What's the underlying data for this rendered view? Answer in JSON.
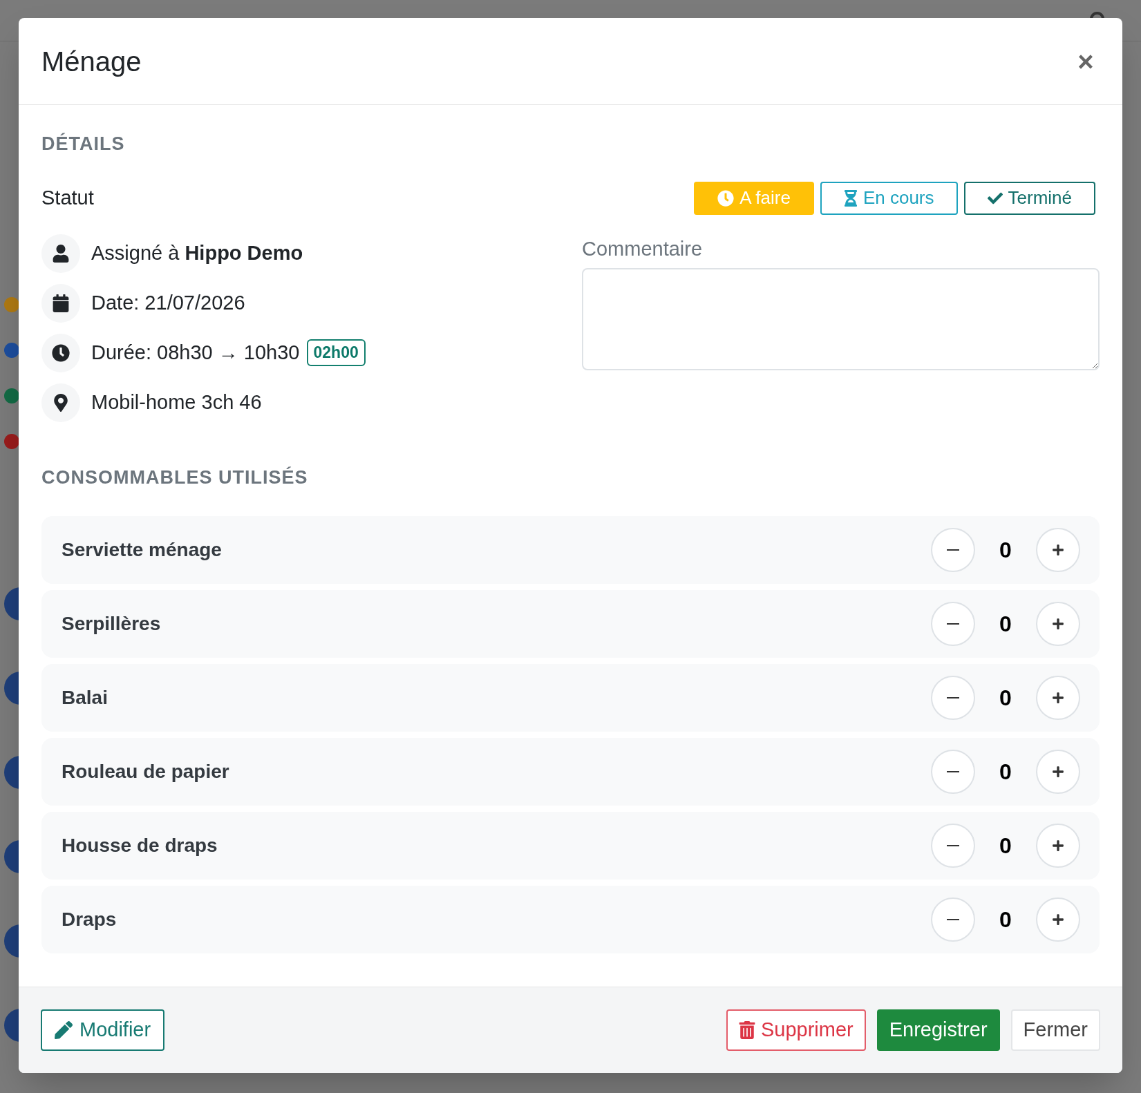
{
  "background": {
    "dots": [
      {
        "color": "#b07a12"
      },
      {
        "color": "#1d4e9e"
      },
      {
        "color": "#136b45"
      },
      {
        "color": "#9a1c1c"
      }
    ]
  },
  "modal": {
    "title": "Ménage",
    "close": "×",
    "details": {
      "heading": "DÉTAILS",
      "status_label": "Statut",
      "statuses": [
        {
          "kind": "todo",
          "label": "A faire",
          "color": "#ffc107",
          "selected": true
        },
        {
          "kind": "progress",
          "label": "En cours",
          "color": "#1ea3bf",
          "selected": false
        },
        {
          "kind": "done",
          "label": "Terminé",
          "color": "#14706b",
          "selected": false
        }
      ],
      "info": [
        {
          "kind": "user",
          "text": "Assigné à **Hippo Demo**"
        },
        {
          "kind": "date",
          "text": "Date: 21/07/2026"
        },
        {
          "kind": "time",
          "text": "Durée: 08h30 → 10h30",
          "badge": "02h00"
        },
        {
          "kind": "place",
          "text": "Mobil-home 3ch 46"
        }
      ],
      "comment": {
        "label": "Commentaire"
      }
    },
    "consumables": {
      "heading": "CONSOMMABLES UTILISÉS",
      "items": [
        {
          "name": "Serviette ménage",
          "count": "0"
        },
        {
          "name": "Serpillères",
          "count": "0"
        },
        {
          "name": "Balai",
          "count": "0"
        },
        {
          "name": "Rouleau de papier",
          "count": "0"
        },
        {
          "name": "Housse de draps",
          "count": "0"
        },
        {
          "name": "Draps",
          "count": "0"
        }
      ]
    },
    "footer": {
      "edit": "Modifier",
      "delete": "Supprimer",
      "save": "Enregistrer",
      "close": "Fermer"
    }
  }
}
